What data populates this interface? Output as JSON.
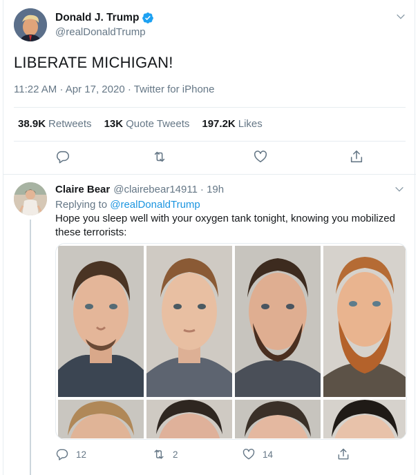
{
  "main_tweet": {
    "author_name": "Donald J. Trump",
    "author_handle": "@realDonaldTrump",
    "text": "LIBERATE MICHIGAN!",
    "time": "11:22 AM",
    "date": "Apr 17, 2020",
    "source": "Twitter for iPhone",
    "dot": "·",
    "stats": [
      {
        "value": "38.9K",
        "label": "Retweets"
      },
      {
        "value": "13K",
        "label": "Quote Tweets"
      },
      {
        "value": "197.2K",
        "label": "Likes"
      }
    ]
  },
  "reply": {
    "author_name": "Claire Bear",
    "author_handle": "@clairebear14911",
    "age": "· 19h",
    "replying_prefix": "Replying to",
    "replying_to": "@realDonaldTrump",
    "text": "Hope you sleep well with your oxygen tank tonight, knowing you mobilized these terrorists:",
    "counts": {
      "reply": "12",
      "retweet": "2",
      "like": "14"
    }
  },
  "icons": {
    "verified": "verified-badge-icon",
    "caret": "chevron-down-icon",
    "reply": "reply-icon",
    "retweet": "retweet-icon",
    "like": "heart-icon",
    "share": "share-icon"
  },
  "colors": {
    "accent": "#1b95e0",
    "muted": "#657786",
    "border": "#e6ecf0"
  }
}
